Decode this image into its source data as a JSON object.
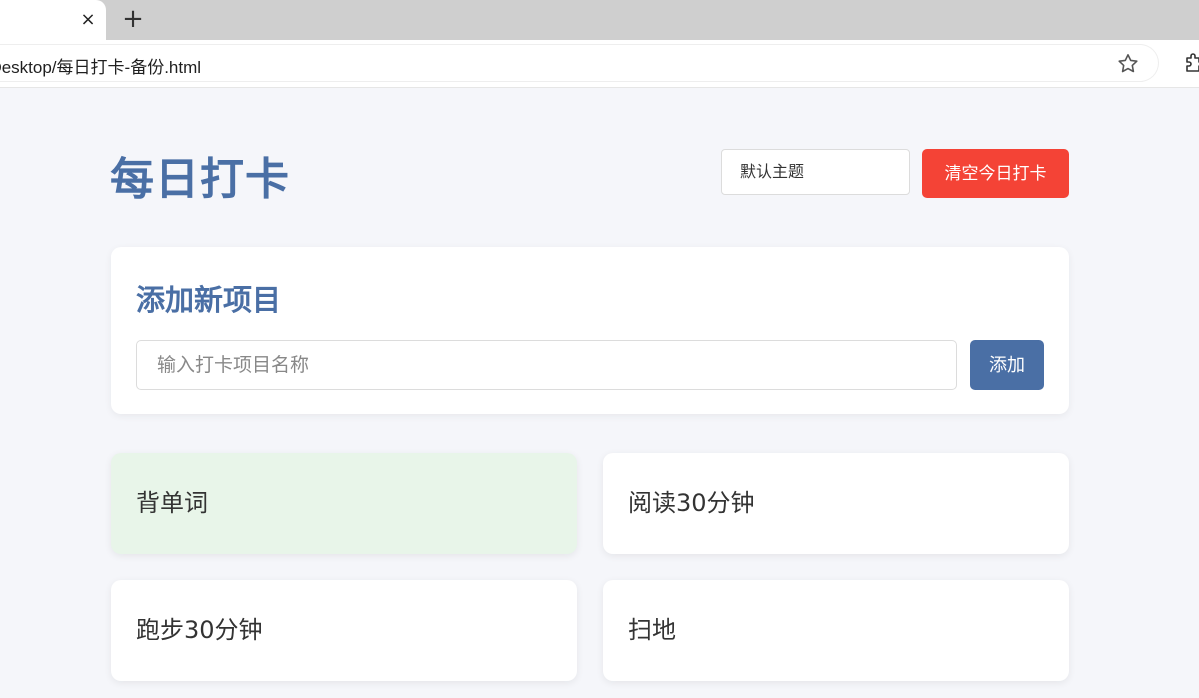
{
  "browser": {
    "tab_close": "×",
    "new_tab": "+",
    "url": "t/Desktop/每日打卡-备份.html"
  },
  "app": {
    "title": "每日打卡",
    "theme_select": "默认主题",
    "clear_button": "清空今日打卡"
  },
  "add_section": {
    "title": "添加新项目",
    "input_placeholder": "输入打卡项目名称",
    "input_value": "",
    "add_button": "添加"
  },
  "items": [
    {
      "label": "背单词",
      "checked": true
    },
    {
      "label": "阅读30分钟",
      "checked": false
    },
    {
      "label": "跑步30分钟",
      "checked": false
    },
    {
      "label": "扫地",
      "checked": false
    }
  ],
  "colors": {
    "accent": "#4a6fa5",
    "danger": "#f44336",
    "done_background": "#e8f5e9",
    "page_background": "#f5f6fa"
  },
  "icons": {
    "bookmark": "star-icon",
    "extensions": "puzzle-icon"
  }
}
